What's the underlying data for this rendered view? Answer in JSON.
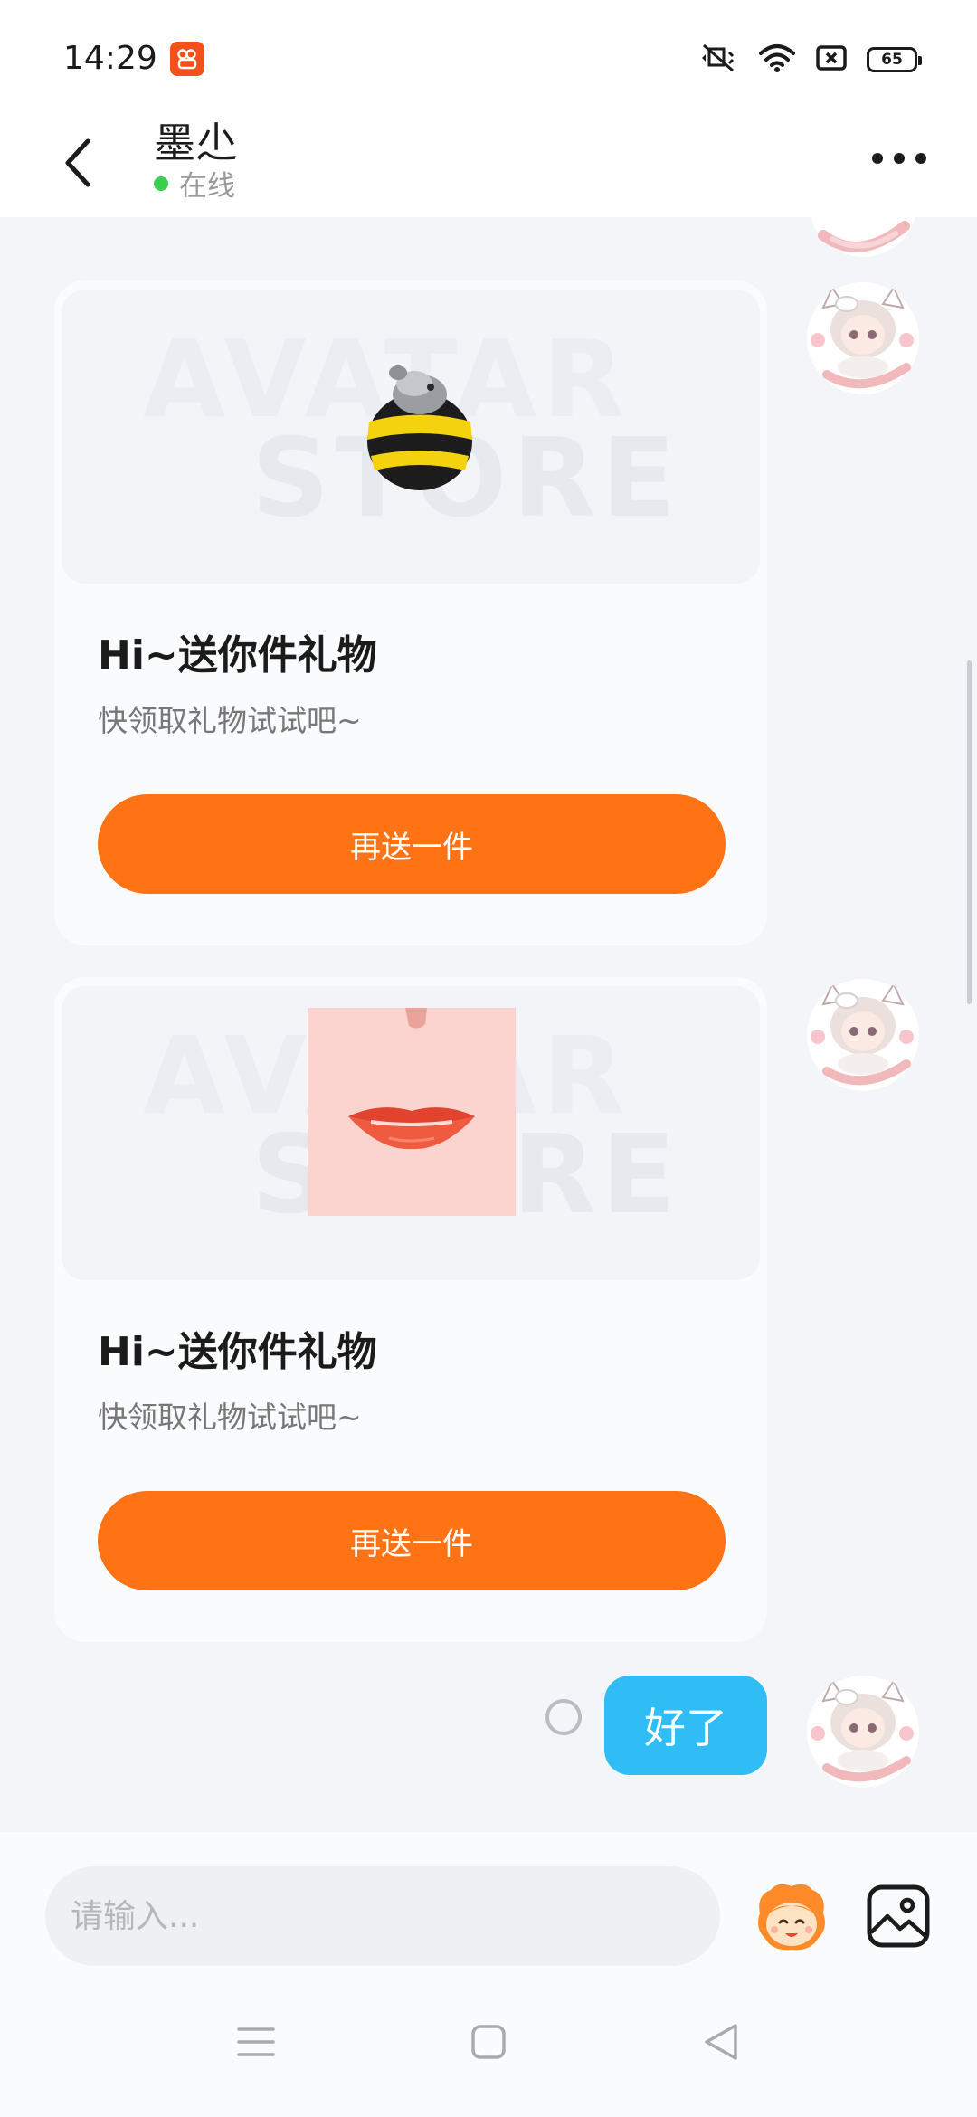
{
  "status_bar": {
    "time": "14:29",
    "battery": "65",
    "icons": [
      "app-badge-icon",
      "mute-icon",
      "wifi-icon",
      "sim-off-icon",
      "battery-icon"
    ]
  },
  "header": {
    "contact_name": "墨尐",
    "online_status": "在线",
    "icons": [
      "back-arrow-icon",
      "more-icon"
    ]
  },
  "chat": {
    "messages": [
      {
        "type": "gift",
        "watermark_line1": "AVATAR",
        "watermark_line2": "STORE",
        "title": "Hi~送你件礼物",
        "subtitle": "快领取礼物试试吧~",
        "button_label": "再送一件"
      },
      {
        "type": "gift",
        "watermark_line1": "AVATAR",
        "watermark_line2": "STORE",
        "title": "Hi~送你件礼物",
        "subtitle": "快领取礼物试试吧~",
        "button_label": "再送一件"
      },
      {
        "type": "text",
        "text": "好了"
      }
    ]
  },
  "input_bar": {
    "placeholder": "请输入...",
    "icons": [
      "emoji-sticker-icon",
      "image-icon"
    ]
  },
  "nav_bar": {
    "icons": [
      "menu-icon",
      "home-icon",
      "back-icon"
    ]
  },
  "colors": {
    "accent_orange": "#ff7314",
    "bubble_blue": "#30bdf6",
    "online_green": "#3ccd4f",
    "background": "#f3f5f9"
  }
}
